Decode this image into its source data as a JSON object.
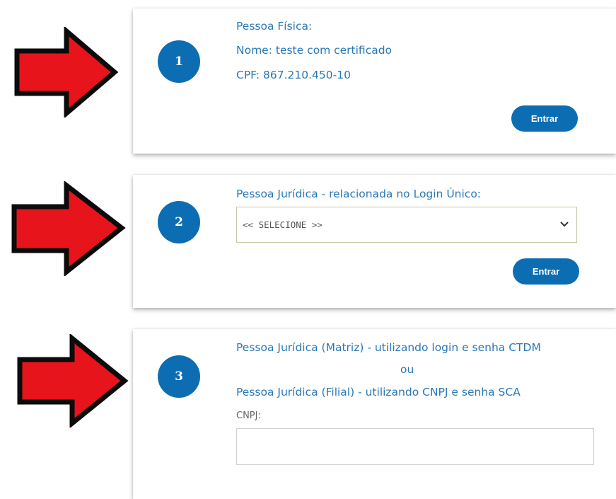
{
  "colors": {
    "accent": "#0d6db3",
    "text_link": "#2a78b6",
    "arrow_red": "#e8141b"
  },
  "icons": [
    "right-arrow-icon",
    "chevron-down-icon"
  ],
  "card1": {
    "number": "1",
    "title": "Pessoa Física:",
    "name_line": "Nome: teste com certificado",
    "cpf_line": "CPF: 867.210.450-10",
    "button": "Entrar"
  },
  "card2": {
    "number": "2",
    "title": "Pessoa Jurídica - relacionada no Login Único:",
    "select_value": "<< SELECIONE >>",
    "button": "Entrar"
  },
  "card3": {
    "number": "3",
    "line1": "Pessoa Jurídica (Matriz) - utilizando login e senha CTDM",
    "or": "ou",
    "line2": "Pessoa Jurídica (Filial) - utilizando CNPJ e senha SCA",
    "cnpj_label": "CNPJ:",
    "cnpj_value": ""
  }
}
